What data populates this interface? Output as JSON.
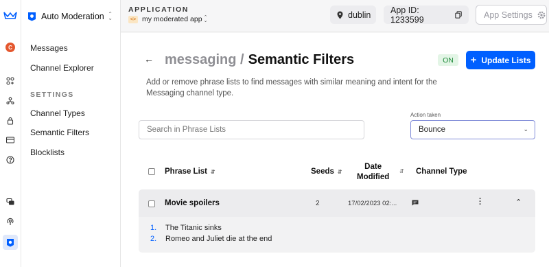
{
  "sidebar": {
    "app_name": "Auto Moderation",
    "avatar_letter": "C",
    "links": [
      {
        "label": "Messages"
      },
      {
        "label": "Channel Explorer"
      }
    ],
    "section_title": "SETTINGS",
    "settings_links": [
      {
        "label": "Channel Types"
      },
      {
        "label": "Semantic Filters"
      },
      {
        "label": "Blocklists"
      }
    ]
  },
  "topbar": {
    "application_label": "APPLICATION",
    "app_name": "my moderated app",
    "region": "dublin",
    "app_id": "App ID: 1233599",
    "settings_label": "App Settings"
  },
  "page": {
    "breadcrumb": "messaging /",
    "title": "Semantic Filters",
    "status_badge": "ON",
    "update_button": "Update Lists",
    "description": "Add or remove phrase lists to find messages with similar meaning and intent for the Messaging channel type."
  },
  "search": {
    "placeholder": "Search in Phrase Lists"
  },
  "action": {
    "label": "Action taken",
    "value": "Bounce"
  },
  "table": {
    "columns": {
      "phrase_list": "Phrase List",
      "seeds": "Seeds",
      "date_line1": "Date",
      "date_line2": "Modified",
      "channel_type": "Channel Type"
    },
    "rows": [
      {
        "name": "Movie spoilers",
        "seeds": "2",
        "date": "17/02/2023 02:...",
        "items": [
          {
            "num": "1.",
            "text": "The Titanic sinks"
          },
          {
            "num": "2.",
            "text": "Romeo and Juliet die at the end"
          }
        ]
      }
    ]
  },
  "colors": {
    "accent": "#005fff",
    "on_badge_bg": "#e3f5e6",
    "on_badge_text": "#1e8a3a"
  }
}
